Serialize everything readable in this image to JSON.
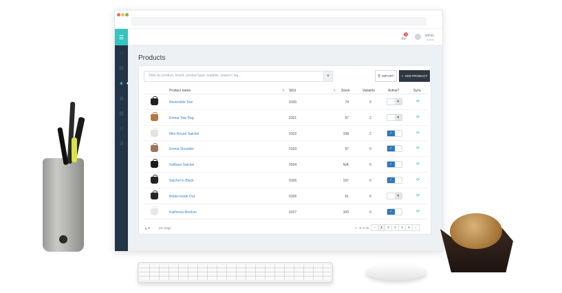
{
  "sidebar": {
    "logo_icon": "menu-icon",
    "items": [
      {
        "icon": "home-icon",
        "active": false
      },
      {
        "icon": "orders-icon",
        "active": false
      },
      {
        "icon": "tag-icon",
        "active": true
      },
      {
        "icon": "box-icon",
        "active": false
      },
      {
        "icon": "document-icon",
        "active": false
      },
      {
        "icon": "user-icon",
        "active": false
      },
      {
        "icon": "gear-icon",
        "active": false
      }
    ]
  },
  "topbar": {
    "notifications_count": "1",
    "user_name": "admin",
    "user_role": "Admin"
  },
  "page": {
    "title": "Products"
  },
  "toolbar": {
    "search_placeholder": "Filter by product, brand, product type, supplier, season, tag...",
    "import_label": "IMPORT",
    "add_label": "ADD PRODUCT"
  },
  "table": {
    "headers": {
      "name": "Product name",
      "sku": "SKU",
      "stock": "Stock",
      "variants": "Variants",
      "active": "Active?",
      "sync": "Sync"
    },
    "rows": [
      {
        "name": "Reversible Tote",
        "sku": "0100",
        "stock": "74",
        "variants": "0",
        "active": false,
        "bag_color": "#1e1e1e"
      },
      {
        "name": "Emma Tote Bag",
        "sku": "0101",
        "stock": "97",
        "variants": "2",
        "active": false,
        "bag_color": "#b4773f"
      },
      {
        "name": "Mini Round Satchel",
        "sku": "0102",
        "stock": "198",
        "variants": "2",
        "active": true,
        "bag_color": "#e6e2dc"
      },
      {
        "name": "Emma Shoulder",
        "sku": "0103",
        "stock": "97",
        "variants": "0",
        "active": true,
        "bag_color": "#a0735a"
      },
      {
        "name": "Saffiano Satchel",
        "sku": "0104",
        "stock": "N/A",
        "variants": "0",
        "active": true,
        "bag_color": "#1c1c1c"
      },
      {
        "name": "Satchel in Black",
        "sku": "0105",
        "stock": "197",
        "variants": "0",
        "active": true,
        "bag_color": "#222222"
      },
      {
        "name": "Bobbi Inside Out",
        "sku": "0106",
        "stock": "51",
        "variants": "6",
        "active": false,
        "bag_color": "#262626"
      },
      {
        "name": "Kalifornia Medium",
        "sku": "0107",
        "stock": "100",
        "variants": "0",
        "active": true,
        "bag_color": "#ebe7e2"
      }
    ]
  },
  "footer": {
    "per_page_value": "8",
    "per_page_label": "per page",
    "range_text": "1 - 8 of 45",
    "pages": [
      "‹",
      "1",
      "2",
      "3",
      "4",
      "5",
      "›"
    ],
    "current_page": "1"
  },
  "colors": {
    "sidebar": "#243447",
    "accent": "#34c5c0",
    "link": "#3d7fc4",
    "toggle_on": "#2d77bd",
    "button_dark": "#2f3842"
  }
}
